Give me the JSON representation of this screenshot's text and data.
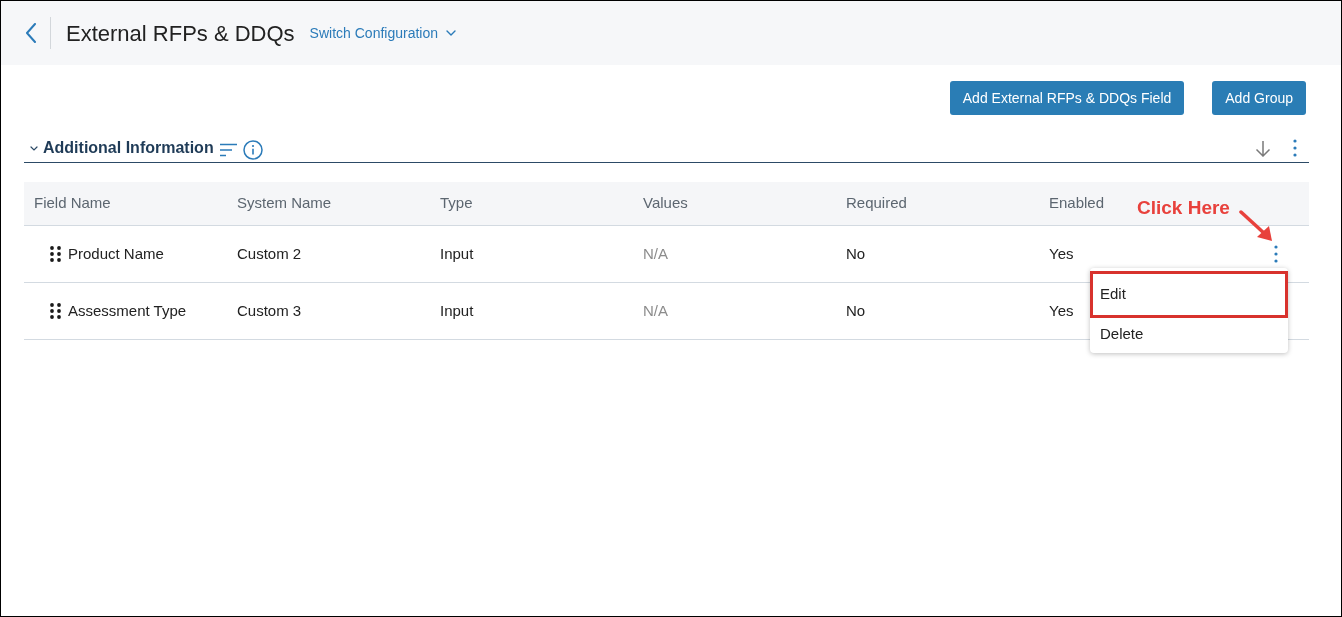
{
  "header": {
    "title": "External RFPs & DDQs",
    "switch_label": "Switch Configuration"
  },
  "actions": [
    "Add External RFPs & DDQs Field",
    "Add Group"
  ],
  "section": {
    "title": "Additional Information",
    "expanded": true
  },
  "table": {
    "columns": [
      "Field Name",
      "System Name",
      "Type",
      "Values",
      "Required",
      "Enabled"
    ],
    "rows": [
      {
        "cells": [
          "Product Name",
          "Custom 2",
          "Input",
          "N/A",
          "No",
          "Yes"
        ],
        "menu_open": true
      },
      {
        "cells": [
          "Assessment Type",
          "Custom 3",
          "Input",
          "N/A",
          "No",
          "Yes"
        ],
        "menu_open": false
      }
    ]
  },
  "row_menu": {
    "items": [
      {
        "label": "Edit",
        "highlighted": true
      },
      {
        "label": "Delete",
        "highlighted": false
      }
    ]
  },
  "annotation": {
    "text": "Click Here"
  }
}
